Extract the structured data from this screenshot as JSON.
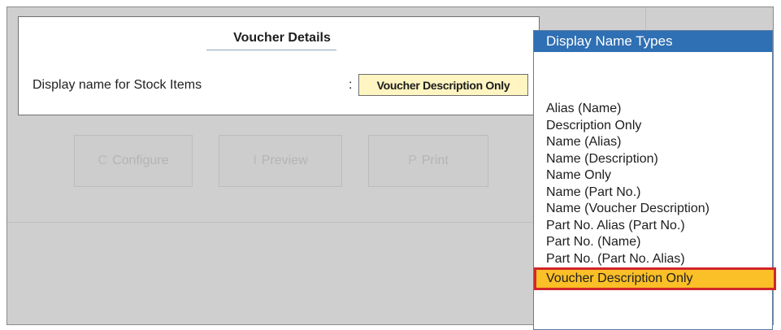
{
  "background": {
    "buttons": [
      {
        "key": "C",
        "label": "Configure"
      },
      {
        "key": "I",
        "label": "Preview"
      },
      {
        "key": "P",
        "label": "Print"
      }
    ]
  },
  "dialog": {
    "title": "Voucher Details",
    "field_label": "Display name for Stock Items",
    "colon": ":",
    "field_value": "Voucher Description Only"
  },
  "dropdown": {
    "header": "Display Name Types",
    "items": [
      "Alias (Name)",
      "Description Only",
      "Name (Alias)",
      "Name (Description)",
      "Name Only",
      "Name (Part No.)",
      "Name (Voucher Description)",
      "Part No. Alias (Part No.)",
      "Part No. (Name)",
      "Part No. (Part No. Alias)",
      "Voucher Description Only"
    ],
    "selected_index": 10
  },
  "colors": {
    "header_bg": "#2f6fb3",
    "selected_bg": "#fbbf27",
    "selected_border": "#d0262b",
    "field_bg": "#fff5c2"
  }
}
